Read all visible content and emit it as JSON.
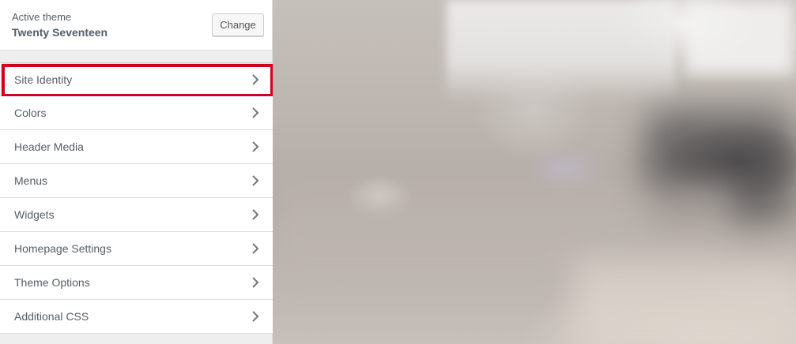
{
  "theme": {
    "label": "Active theme",
    "name": "Twenty Seventeen",
    "change_label": "Change"
  },
  "sections": [
    {
      "label": "Site Identity",
      "highlighted": true
    },
    {
      "label": "Colors"
    },
    {
      "label": "Header Media"
    },
    {
      "label": "Menus"
    },
    {
      "label": "Widgets"
    },
    {
      "label": "Homepage Settings"
    },
    {
      "label": "Theme Options"
    },
    {
      "label": "Additional CSS"
    }
  ],
  "icons": {
    "section_arrow": "chevron-right-icon"
  },
  "colors": {
    "highlight": "#d0021b",
    "text": "#555d66"
  }
}
